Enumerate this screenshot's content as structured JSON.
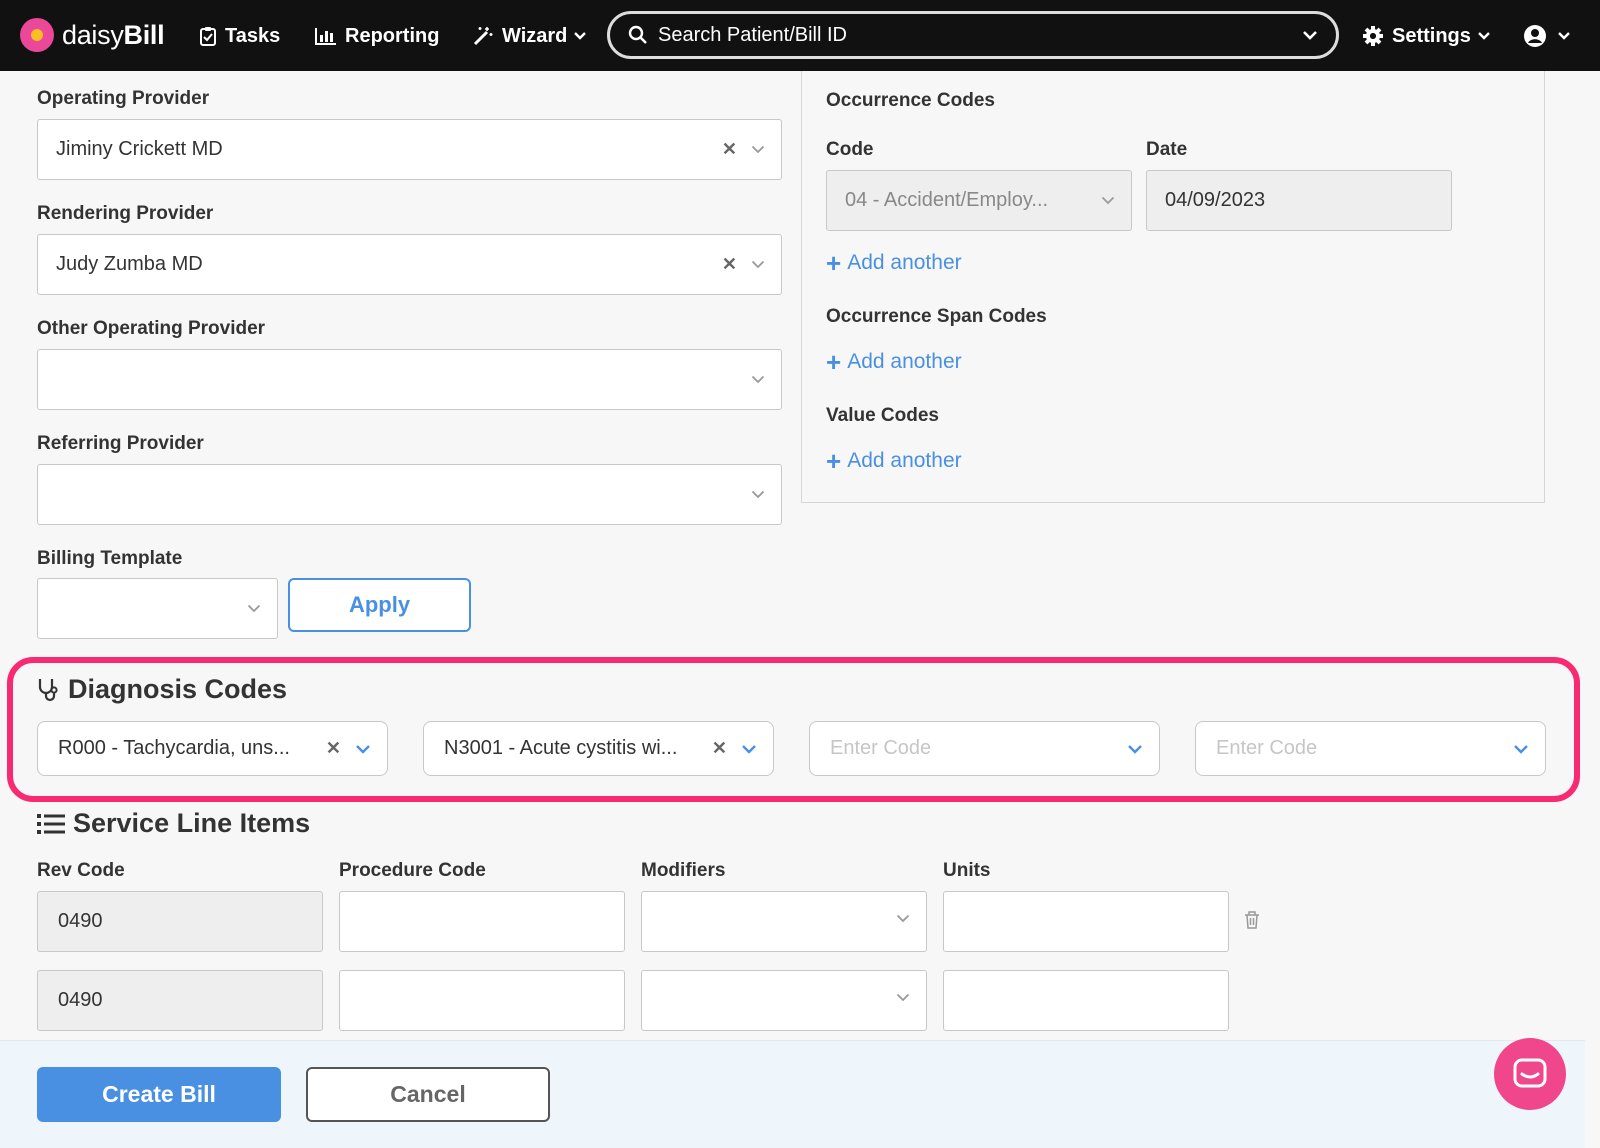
{
  "nav": {
    "brand_light": "daisy",
    "brand_bold": "Bill",
    "tasks": "Tasks",
    "reporting": "Reporting",
    "wizard": "Wizard",
    "search_placeholder": "Search Patient/Bill ID",
    "settings": "Settings"
  },
  "providers": {
    "operating_label": "Operating Provider",
    "operating_value": "Jiminy Crickett MD",
    "rendering_label": "Rendering Provider",
    "rendering_value": "Judy Zumba MD",
    "other_operating_label": "Other Operating Provider",
    "other_operating_value": "",
    "referring_label": "Referring Provider",
    "referring_value": "",
    "billing_template_label": "Billing Template",
    "billing_template_value": "",
    "apply_label": "Apply"
  },
  "occurrence": {
    "title": "Occurrence Codes",
    "code_label": "Code",
    "date_label": "Date",
    "code_value": "04 - Accident/Employ...",
    "date_value": "04/09/2023",
    "add_another": "Add another",
    "span_title": "Occurrence Span Codes",
    "value_title": "Value Codes"
  },
  "diagnosis": {
    "title": "Diagnosis Codes",
    "codes": [
      "R000 - Tachycardia, uns...",
      "N3001 - Acute cystitis wi..."
    ],
    "placeholder": "Enter Code"
  },
  "service_lines": {
    "title": "Service Line Items",
    "columns": [
      "Rev Code",
      "Procedure Code",
      "Modifiers",
      "Units"
    ],
    "rows": [
      {
        "rev_code": "0490",
        "procedure_code": "",
        "modifiers": "",
        "units": ""
      },
      {
        "rev_code": "0490",
        "procedure_code": "",
        "modifiers": "",
        "units": ""
      }
    ]
  },
  "footer": {
    "create_label": "Create Bill",
    "cancel_label": "Cancel"
  },
  "colors": {
    "accent": "#4a90e2",
    "highlight": "#f72a72",
    "chat": "#f0468c",
    "nav_bg": "#111111"
  }
}
